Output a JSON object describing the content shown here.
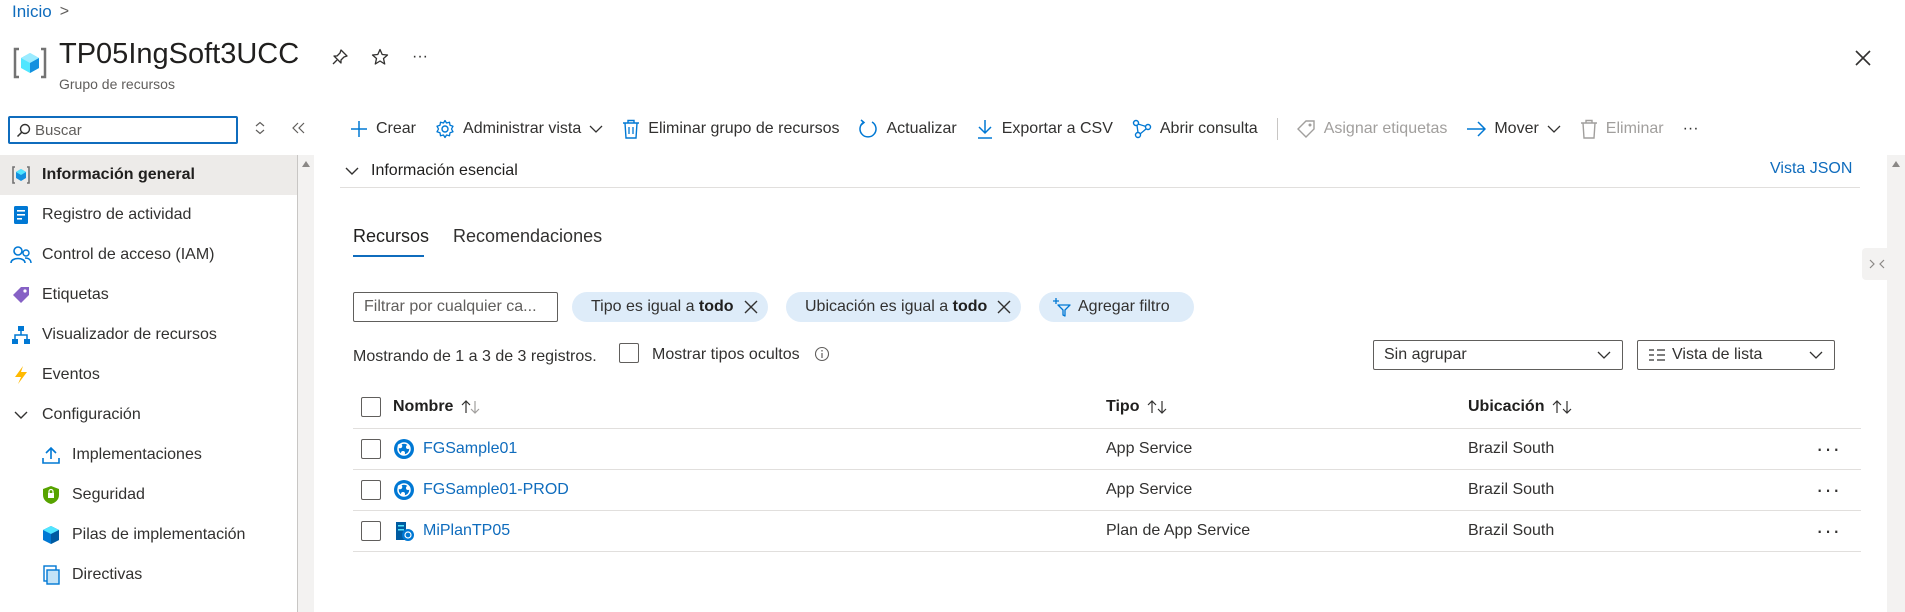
{
  "breadcrumb": {
    "home": "Inicio",
    "separator": ">"
  },
  "header": {
    "title": "TP05IngSoft3UCC",
    "subtitle": "Grupo de recursos",
    "more": "···"
  },
  "sidebar": {
    "search_placeholder": "Buscar",
    "items": [
      {
        "label": "Información general",
        "icon": "resource-group-icon"
      },
      {
        "label": "Registro de actividad",
        "icon": "activity-log-icon"
      },
      {
        "label": "Control de acceso (IAM)",
        "icon": "iam-icon"
      },
      {
        "label": "Etiquetas",
        "icon": "tag-icon"
      },
      {
        "label": "Visualizador de recursos",
        "icon": "resource-visualizer-icon"
      },
      {
        "label": "Eventos",
        "icon": "lightning-icon"
      },
      {
        "label": "Configuración",
        "icon": "chevron-down-icon"
      },
      {
        "label": "Implementaciones",
        "icon": "upload-icon"
      },
      {
        "label": "Seguridad",
        "icon": "shield-icon"
      },
      {
        "label": "Pilas de implementación",
        "icon": "stack-icon"
      },
      {
        "label": "Directivas",
        "icon": "policy-icon"
      }
    ]
  },
  "toolbar": {
    "create": "Crear",
    "manage_view": "Administrar vista",
    "delete_rg": "Eliminar grupo de recursos",
    "refresh": "Actualizar",
    "export_csv": "Exportar a CSV",
    "open_query": "Abrir consulta",
    "assign_tags": "Asignar etiquetas",
    "move": "Mover",
    "delete": "Eliminar",
    "more": "···"
  },
  "essentials": {
    "label": "Información esencial",
    "json_view": "Vista JSON"
  },
  "tabs": [
    "Recursos",
    "Recomendaciones"
  ],
  "filters": {
    "placeholder": "Filtrar por cualquier ca...",
    "type_prefix": "Tipo es igual a ",
    "type_value": "todo",
    "location_prefix": "Ubicación es igual a ",
    "location_value": "todo",
    "add_filter": "Agregar filtro"
  },
  "records_text": "Mostrando de 1 a 3 de 3 registros.",
  "show_hidden_label": "Mostrar tipos ocultos",
  "grouping": "Sin agrupar",
  "view_mode": "Vista de lista",
  "table": {
    "columns": [
      "Nombre",
      "Tipo",
      "Ubicación"
    ],
    "rows": [
      {
        "name": "FGSample01",
        "type": "App Service",
        "location": "Brazil South",
        "icon": "app-service-icon"
      },
      {
        "name": "FGSample01-PROD",
        "type": "App Service",
        "location": "Brazil South",
        "icon": "app-service-icon"
      },
      {
        "name": "MiPlanTP05",
        "type": "Plan de App Service",
        "location": "Brazil South",
        "icon": "app-service-plan-icon"
      }
    ],
    "row_more": "···"
  },
  "colors": {
    "accent": "#0f6cbd",
    "pill": "#deecf9",
    "active_bg": "#edebe9"
  }
}
